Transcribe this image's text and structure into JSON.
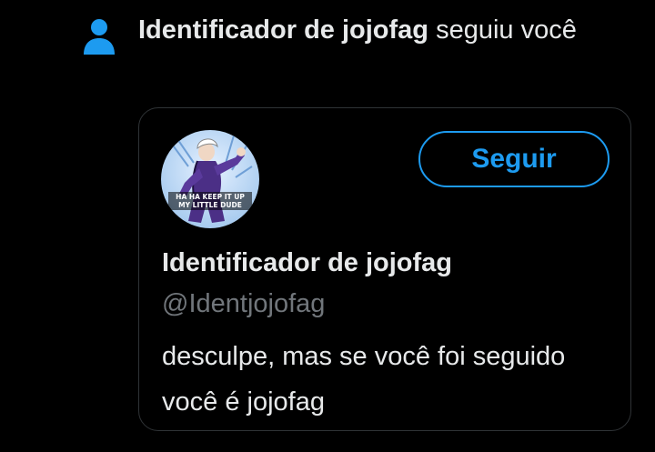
{
  "notification": {
    "icon": "person-icon",
    "icon_color": "#1d9bf0",
    "actor_name": "Identificador de jojofag",
    "action_text": " seguiu você"
  },
  "user_card": {
    "avatar": {
      "description": "manga-avatar",
      "caption_line1": "HA HA KEEP IT UP",
      "caption_line2": "MY LITTLE DUDE"
    },
    "follow_button_label": "Seguir",
    "display_name": "Identificador de jojofag",
    "handle": "@Identjojofag",
    "bio": "desculpe, mas se você foi seguido você é jojofag"
  },
  "colors": {
    "background": "#000000",
    "accent": "#1d9bf0",
    "primary_text": "#e7e9ea",
    "secondary_text": "#71767b",
    "card_border": "#2f3336"
  }
}
